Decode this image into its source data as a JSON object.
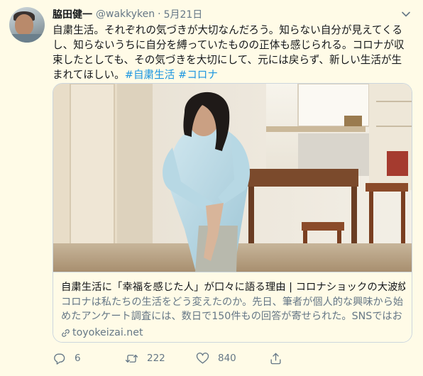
{
  "tweet": {
    "name": "脇田健一",
    "handle": "@wakkyken",
    "separator": "·",
    "date": "5月21日",
    "body_text": "自粛生活。それぞれの気づきが大切なんだろう。知らない自分が見えてくるし、知らないうちに自分を縛っていたものの正体も感じられる。コロナが収束したとしても、その気づきを大切にして、元には戻らず、新しい生活が生まれてほしい。",
    "hashtags": [
      "#自粛生活",
      "#コロナ"
    ]
  },
  "card": {
    "title": "自粛生活に「幸福を感じた人」が口々に語る理由 | コロナショックの大波紋",
    "description": "コロナは私たちの生活をどう変えたのか。先日、筆者が個人的な興味から始めたアンケート調査には、数日で150件もの回答が寄せられた。SNSではおお...",
    "domain": "toyokeizai.net"
  },
  "actions": {
    "reply_count": "6",
    "retweet_count": "222",
    "like_count": "840"
  },
  "icons": {
    "chevron": "chevron-down-icon",
    "link": "link-icon",
    "reply": "reply-icon",
    "retweet": "retweet-icon",
    "like": "heart-icon",
    "share": "share-icon"
  },
  "colors": {
    "background": "#fffbe7",
    "text": "#14171a",
    "muted": "#657786",
    "accent": "#1b95e0",
    "border": "#ccd6dd"
  }
}
